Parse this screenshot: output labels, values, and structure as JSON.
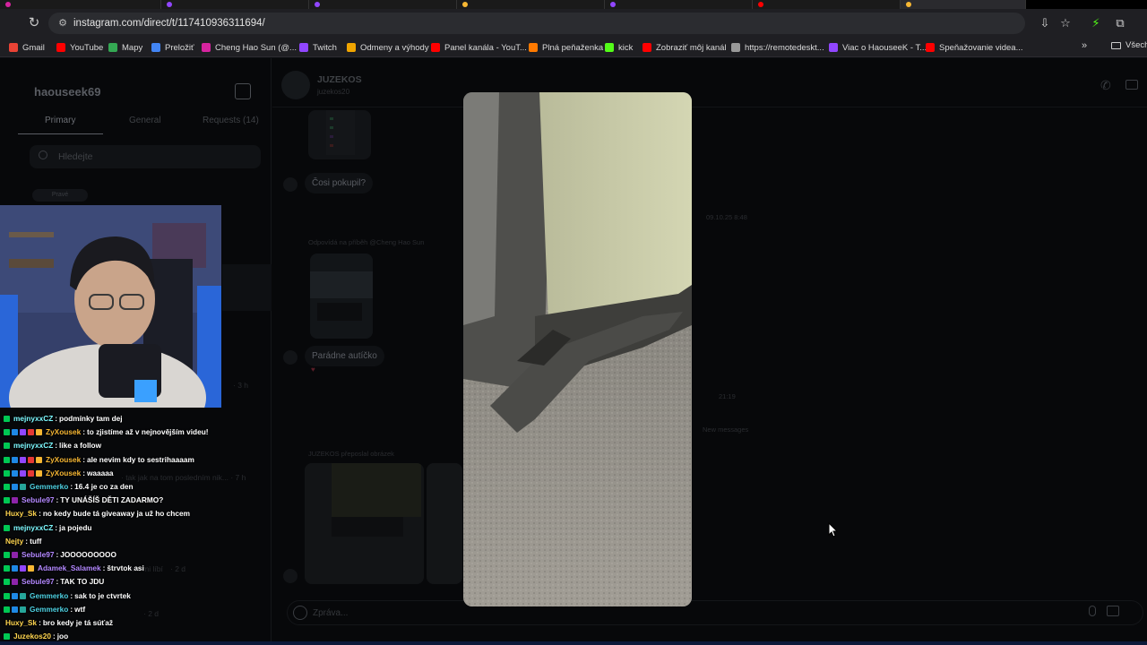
{
  "browser": {
    "url": "instagram.com/direct/t/117410936311694/",
    "bookmarks": [
      {
        "label": "Gmail",
        "color": "#ea4335"
      },
      {
        "label": "YouTube",
        "color": "#ff0000"
      },
      {
        "label": "Mapy",
        "color": "#34a853"
      },
      {
        "label": "Preložiť",
        "color": "#4285f4"
      },
      {
        "label": "Cheng Hao Sun (@...",
        "color": "#d6249f"
      },
      {
        "label": "Twitch",
        "color": "#9146ff"
      },
      {
        "label": "Odmeny a výhody",
        "color": "#f0a500"
      },
      {
        "label": "Panel kanála - YouT...",
        "color": "#ff0000"
      },
      {
        "label": "Plná peňaženka",
        "color": "#ff7a00"
      },
      {
        "label": "kick",
        "color": "#53fc18"
      },
      {
        "label": "Zobraziť môj kanál",
        "color": "#ff0000"
      },
      {
        "label": "https://remotedeskt...",
        "color": "#999999"
      },
      {
        "label": "Viac o HaouseeK - T...",
        "color": "#9146ff"
      },
      {
        "label": "Speňažovanie videa...",
        "color": "#ff0000"
      }
    ],
    "all_bookmarks": "Všech"
  },
  "instagram": {
    "account": "haouseek69",
    "tabs": [
      "Primary",
      "General",
      "Requests (14)"
    ],
    "search_placeholder": "Hledejte",
    "filter_pill": "Pravé",
    "chat_name": "JUZEKOS",
    "chat_handle": "juzekos20",
    "messages": {
      "m1": "Čosi pokupil?",
      "reply_meta": "Odpovídá na příběh @Cheng Hao Sun",
      "m2": "Parádne autíčko",
      "time1": "09.10.25 8:48",
      "time2": "21:19",
      "new_messages": "New messages",
      "forwarded": "JUZEKOS přeposlal obrázek"
    },
    "ghost_items": [
      "· 3 h",
      "· tak jak na tom posledním nik... · 7 h",
      "· 2 d",
      "· 2 d",
      "me mi líbí"
    ],
    "composer_placeholder": "Zpráva..."
  },
  "twitch_chat": [
    {
      "user": "mejnyxxCZ",
      "color": "#7df9ff",
      "text": "podmínky tam dej",
      "badges": [
        "#00c853"
      ]
    },
    {
      "user": "ZyXousek",
      "color": "#f7b733",
      "text": "to zjistíme až v nejnovějším videu!",
      "badges": [
        "#00c853",
        "#1e88e5",
        "#9146ff",
        "#e53935",
        "#f7b733"
      ]
    },
    {
      "user": "mejnyxxCZ",
      "color": "#7df9ff",
      "text": "like a follow",
      "badges": [
        "#00c853"
      ]
    },
    {
      "user": "ZyXousek",
      "color": "#f7b733",
      "text": "ale nevim kdy to sestrihaaaam",
      "badges": [
        "#00c853",
        "#1e88e5",
        "#9146ff",
        "#e53935",
        "#f7b733"
      ]
    },
    {
      "user": "ZyXousek",
      "color": "#f7b733",
      "text": "waaaaa",
      "badges": [
        "#00c853",
        "#1e88e5",
        "#9146ff",
        "#e53935",
        "#f7b733"
      ]
    },
    {
      "user": "Gemmerko",
      "color": "#4dd0e1",
      "text": "16.4 je co za den",
      "badges": [
        "#00c853",
        "#1e88e5",
        "#26a69a"
      ]
    },
    {
      "user": "Sebule97",
      "color": "#b388ff",
      "text": "TY UNÁŠÍŠ DĚTI ZADARMO?",
      "badges": [
        "#00c853",
        "#8e24aa"
      ]
    },
    {
      "user": "Huxy_Sk",
      "color": "#ffd54f",
      "text": "no kedy bude tá giveaway ja už ho chcem",
      "badges": []
    },
    {
      "user": "mejnyxxCZ",
      "color": "#7df9ff",
      "text": "ja pojedu",
      "badges": [
        "#00c853"
      ]
    },
    {
      "user": "Nejty",
      "color": "#ffd54f",
      "text": "tuff",
      "badges": []
    },
    {
      "user": "Sebule97",
      "color": "#b388ff",
      "text": "JOOOOOOOOO",
      "badges": [
        "#00c853",
        "#8e24aa"
      ]
    },
    {
      "user": "Adamek_Salamek",
      "color": "#b388ff",
      "text": "štrvtok asi",
      "badges": [
        "#00c853",
        "#1e88e5",
        "#9146ff",
        "#f7b733"
      ]
    },
    {
      "user": "Sebule97",
      "color": "#b388ff",
      "text": "TAK TO JDU",
      "badges": [
        "#00c853",
        "#8e24aa"
      ]
    },
    {
      "user": "Gemmerko",
      "color": "#4dd0e1",
      "text": "sak to je ctvrtek",
      "badges": [
        "#00c853",
        "#1e88e5",
        "#26a69a"
      ]
    },
    {
      "user": "Gemmerko",
      "color": "#4dd0e1",
      "text": "wtf",
      "badges": [
        "#00c853",
        "#1e88e5",
        "#26a69a"
      ]
    },
    {
      "user": "Huxy_Sk",
      "color": "#ffd54f",
      "text": "bro kedy je tá súťaž",
      "badges": []
    },
    {
      "user": "Juzekos20",
      "color": "#ffd54f",
      "text": "joo",
      "badges": [
        "#00c853"
      ]
    }
  ]
}
